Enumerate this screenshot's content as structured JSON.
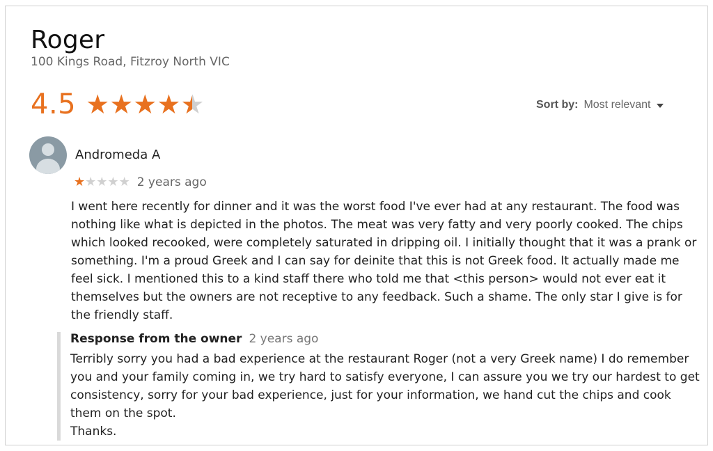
{
  "business": {
    "name": "Roger",
    "address": "100 Kings Road, Fitzroy North VIC",
    "rating": "4.5",
    "rating_value": 4.5,
    "rating_max": 5
  },
  "sort": {
    "label": "Sort by:",
    "value": "Most relevant"
  },
  "review": {
    "author": "Andromeda A",
    "stars": 1,
    "age": "2 years ago",
    "text": "I went here recently for dinner and it was the worst food I've ever had at any restaurant. The food was nothing like what is depicted in the photos. The meat was very fatty and very poorly cooked. The chips which looked recooked, were completely saturated in dripping oil. I initially thought that it was a prank or something. I'm a proud Greek and I can say for deinite that this is not Greek food. It actually made me feel sick. I mentioned this to a kind staff there who told me that <this person> would not ever eat it themselves but the owners are not receptive to any feedback. Such a shame. The only star I give is for the friendly staff."
  },
  "owner_response": {
    "title": "Response from the owner",
    "age": "2 years ago",
    "text": "Terribly sorry you had a bad experience at the restaurant Roger (not a very Greek name) I do remember you and your family coming in, we try hard to satisfy everyone, I can assure you we try our hardest to get consistency, sorry for your bad experience, just for your information, we hand cut the chips and cook them on the spot.\nThanks."
  },
  "colors": {
    "star": "#e8711f",
    "star_empty": "#d0d0d0",
    "rating_text": "#e8711f"
  },
  "icons": {
    "sort_caret": "caret-down-icon",
    "avatar": "default-avatar-icon",
    "star": "star-icon"
  }
}
